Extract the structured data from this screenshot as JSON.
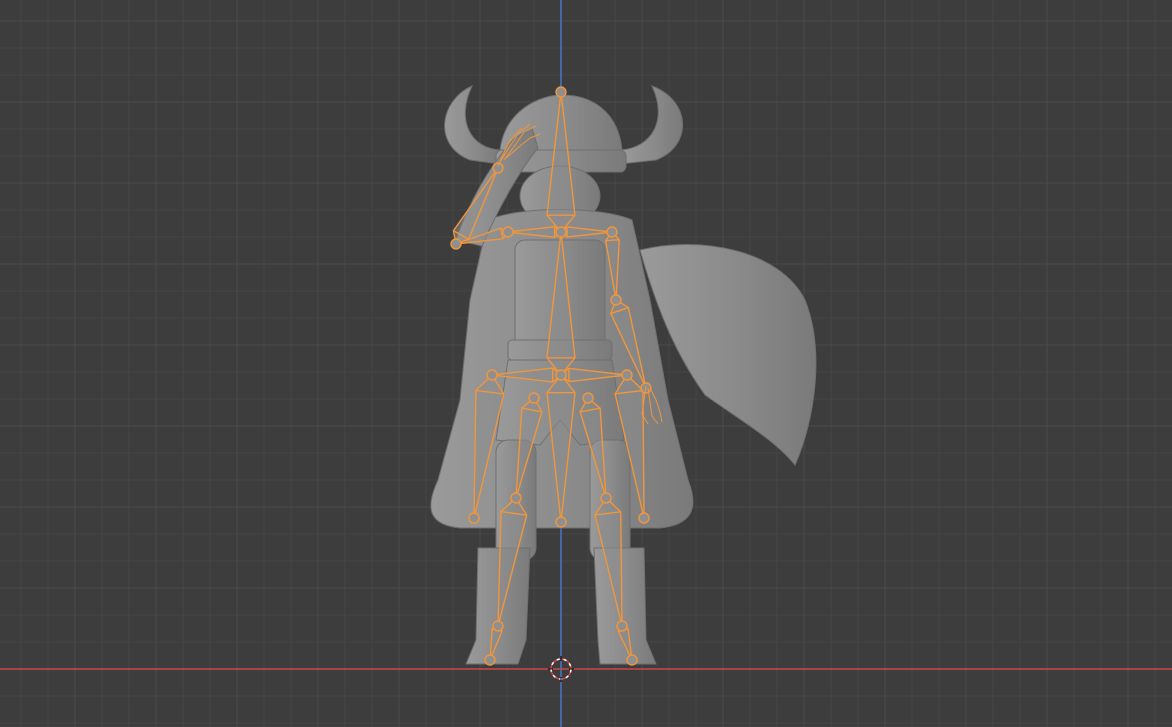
{
  "viewport": {
    "name": "3d-viewport",
    "background": "#3d3d3d",
    "grid_minor_color": "#454545",
    "grid_major_color": "#4c4c4c",
    "x_axis_color": "#c84a4a",
    "z_axis_color": "#4a74c8",
    "view": "front-orthographic"
  },
  "scene": {
    "mesh": {
      "name": "character-mesh",
      "color": "#8c8c8c"
    },
    "armature": {
      "name": "armature",
      "color": "#f0963c",
      "selected": true,
      "display": "octahedral"
    },
    "cursor": {
      "name": "3d-cursor",
      "colors": [
        "#ffffff",
        "#d84040"
      ]
    }
  }
}
